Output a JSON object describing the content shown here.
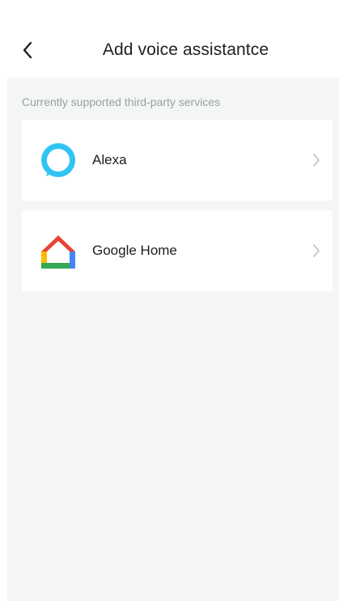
{
  "header": {
    "title": "Add voice assistantce",
    "back_icon": "chevron-left-icon"
  },
  "section": {
    "label": "Currently supported third-party services"
  },
  "services": [
    {
      "name": "Alexa",
      "icon": "alexa-icon",
      "accent": "#31c4f3",
      "arrow_icon": "chevron-right-icon"
    },
    {
      "name": "Google Home",
      "icon": "google-home-icon",
      "colors": [
        "#ea4335",
        "#fbbc04",
        "#34a853",
        "#4285f4"
      ],
      "arrow_icon": "chevron-right-icon"
    }
  ],
  "colors": {
    "background": "#f4f5f5",
    "card": "#ffffff",
    "muted_text": "#9aa0a6"
  }
}
